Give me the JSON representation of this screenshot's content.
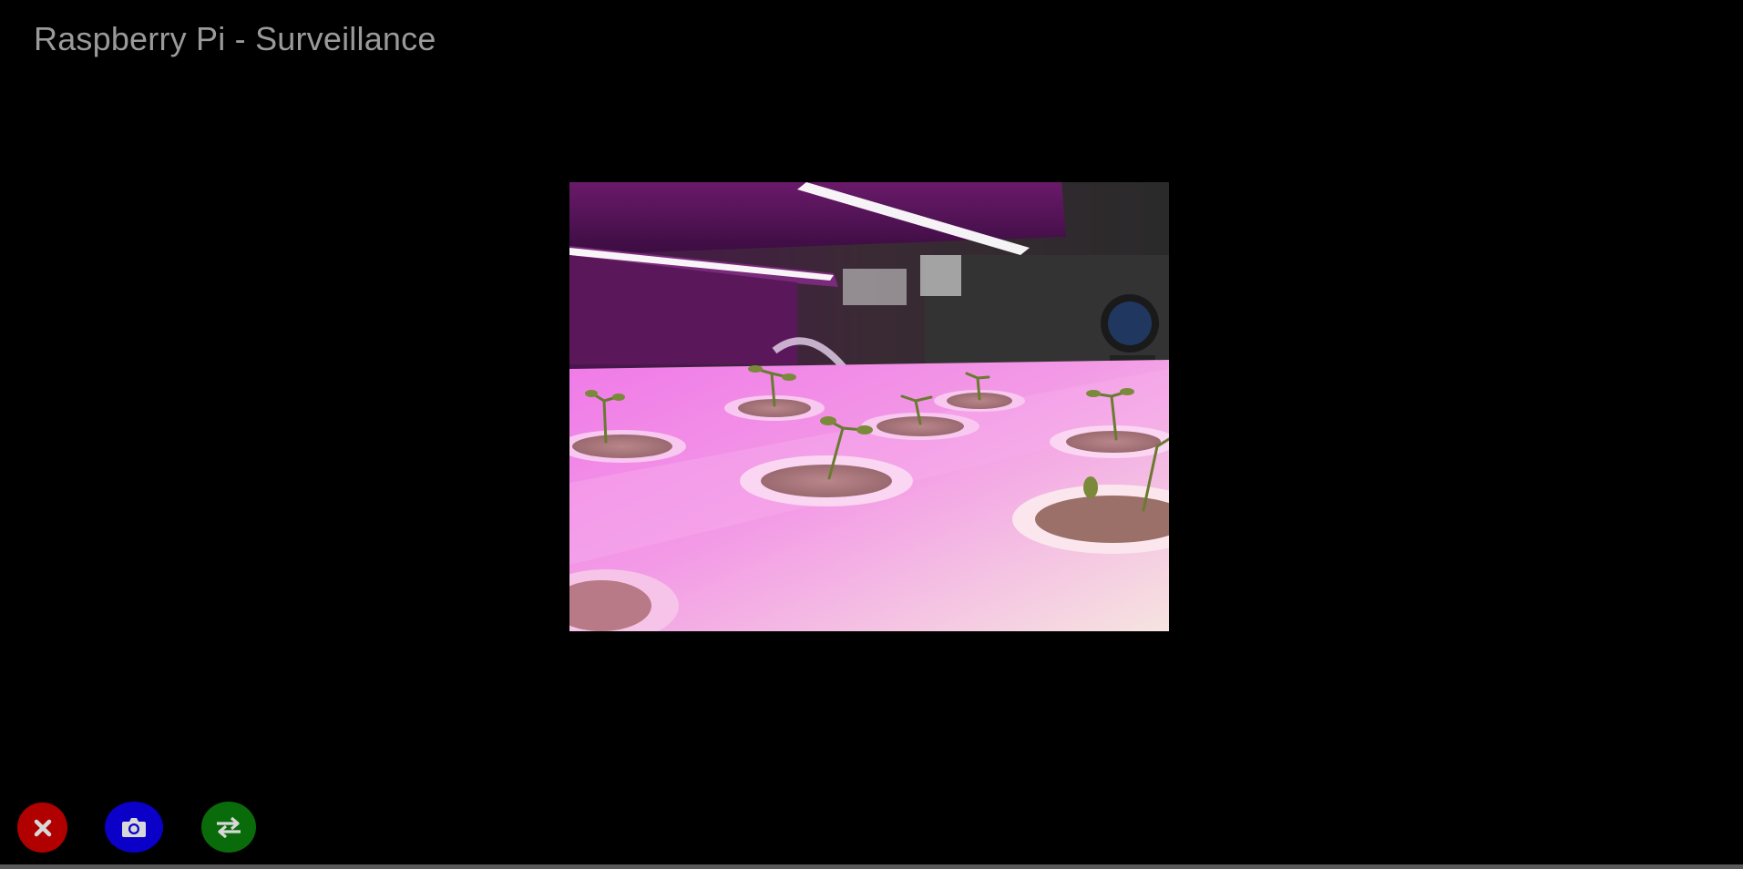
{
  "page": {
    "title": "Raspberry Pi - Surveillance",
    "background_color": "#000000",
    "title_color": "#9a9a9a"
  },
  "video": {
    "description_icon": "camera-feed-image"
  },
  "controls": {
    "stop": {
      "icon": "close-icon",
      "color": "#b00000"
    },
    "snapshot": {
      "icon": "camera-icon",
      "color": "#0a00c8"
    },
    "switch": {
      "icon": "swap-arrows-icon",
      "color": "#0a6b0a"
    }
  }
}
